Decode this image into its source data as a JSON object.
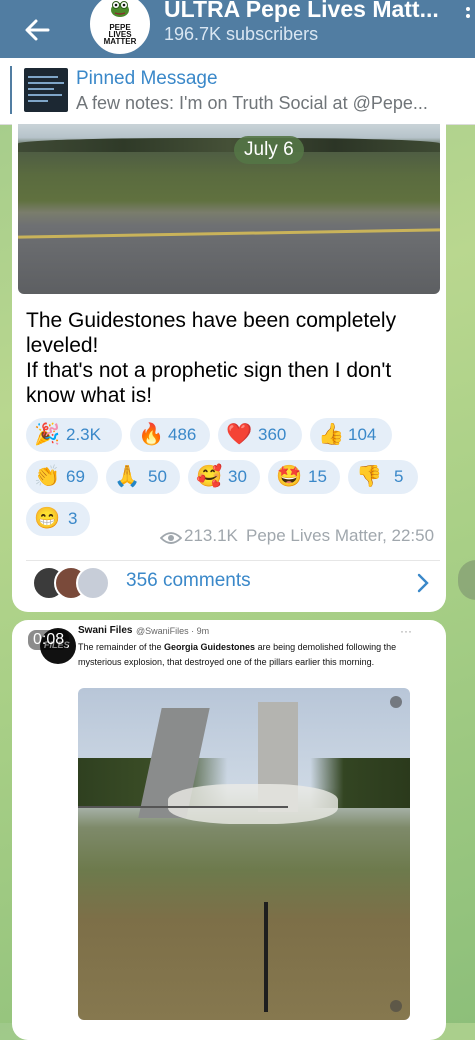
{
  "header": {
    "title": "ULTRA Pepe Lives Matt...",
    "subscribers": "196.7K subscribers",
    "avatar_text": [
      "PEPE",
      "LIVES",
      "MATTER"
    ]
  },
  "pinned": {
    "title": "Pinned Message",
    "text": "A few notes: I'm on Truth Social at @Pepe..."
  },
  "message": {
    "date": "July 6",
    "text_lines": [
      "The Guidestones have been completely",
      "leveled!",
      "If that's not a prophetic sign then I don't",
      "know what is!"
    ],
    "reactions": [
      {
        "icon": "🎉",
        "count": "2.3K"
      },
      {
        "icon": "🔥",
        "count": "486"
      },
      {
        "icon": "❤️",
        "count": "360"
      },
      {
        "icon": "👍",
        "count": "104"
      },
      {
        "icon": "👏",
        "count": "69"
      },
      {
        "icon": "🙏",
        "count": "50"
      },
      {
        "icon": "🥰",
        "count": "30"
      },
      {
        "icon": "🤩",
        "count": "15"
      },
      {
        "icon": "👎",
        "count": "5"
      },
      {
        "icon": "😁",
        "count": "3"
      }
    ],
    "views": "213.1K",
    "author_time": "Pepe Lives Matter, 22:50",
    "comments": "356 comments"
  },
  "message2": {
    "duration": "0:08",
    "tweet_name": "Swani Files",
    "tweet_handle": "@SwaniFiles · 9m",
    "tweet_pre": "The remainder of the ",
    "tweet_bold": "Georgia Guidestones",
    "tweet_post": " are being demolished following the mysterious explosion, that destroyed one of the pillars earlier this morning.",
    "avatar_text": "FILES"
  },
  "colors": {
    "header": "#517da2",
    "link": "#3a88c9",
    "reaction_bg": "#e5eef8"
  }
}
